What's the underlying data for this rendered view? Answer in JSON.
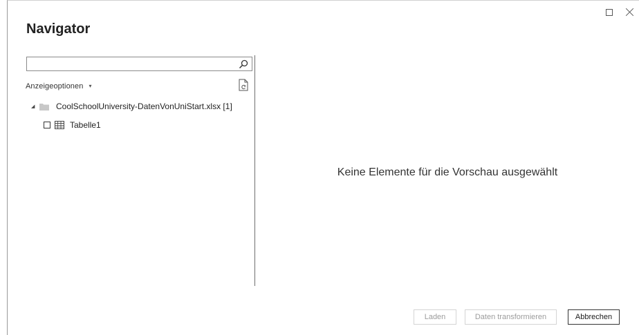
{
  "title": "Navigator",
  "search": {
    "value": "",
    "placeholder": ""
  },
  "options": {
    "label": "Anzeigeoptionen",
    "caret": "▾"
  },
  "tree": {
    "file": {
      "expand_glyph": "◢",
      "label": "CoolSchoolUniversity-DatenVonUniStart.xlsx [1]"
    },
    "items": [
      {
        "label": "Tabelle1",
        "checked": false
      }
    ]
  },
  "preview": {
    "empty_message": "Keine Elemente für die Vorschau ausgewählt"
  },
  "buttons": {
    "load": "Laden",
    "transform": "Daten transformieren",
    "cancel": "Abbrechen"
  },
  "colors": {
    "folder": "#c8c8c8",
    "disabled_text": "#9c9c9c",
    "divider": "#6e6e6e"
  }
}
